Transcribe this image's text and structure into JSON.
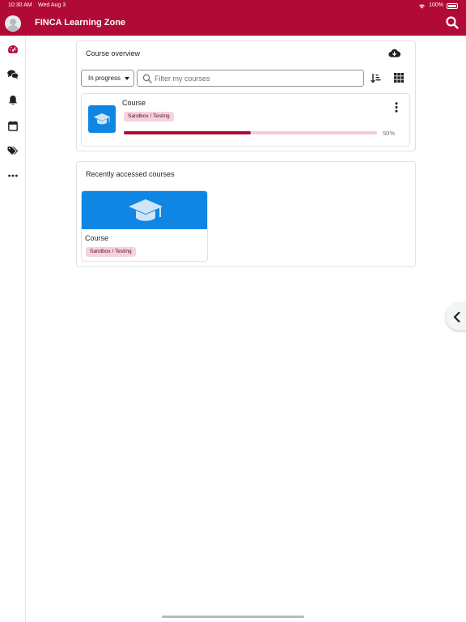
{
  "status_bar": {
    "time": "10:30 AM",
    "date": "Wed Aug 3",
    "battery": "100%"
  },
  "app_bar": {
    "title": "FINCA Learning Zone"
  },
  "rail": {
    "items": [
      {
        "name": "dashboard",
        "icon": "gauge-icon"
      },
      {
        "name": "messages",
        "icon": "chat-icon"
      },
      {
        "name": "notifications",
        "icon": "bell-icon"
      },
      {
        "name": "calendar",
        "icon": "calendar-icon"
      },
      {
        "name": "tags",
        "icon": "tags-icon"
      },
      {
        "name": "more",
        "icon": "ellipsis-icon"
      }
    ]
  },
  "course_overview": {
    "title": "Course overview",
    "filter_selected": "In progress",
    "search_placeholder": "Filter my courses",
    "courses": [
      {
        "name": "Course",
        "category": "Sandbox / Testing",
        "progress": 50,
        "progress_label": "50%"
      }
    ]
  },
  "recent": {
    "title": "Recently accessed courses",
    "courses": [
      {
        "name": "Course",
        "category": "Sandbox / Testing"
      }
    ]
  },
  "colors": {
    "brand": "#b10a37",
    "course_image": "#0f86e4",
    "badge_bg": "#f5d2dc"
  }
}
